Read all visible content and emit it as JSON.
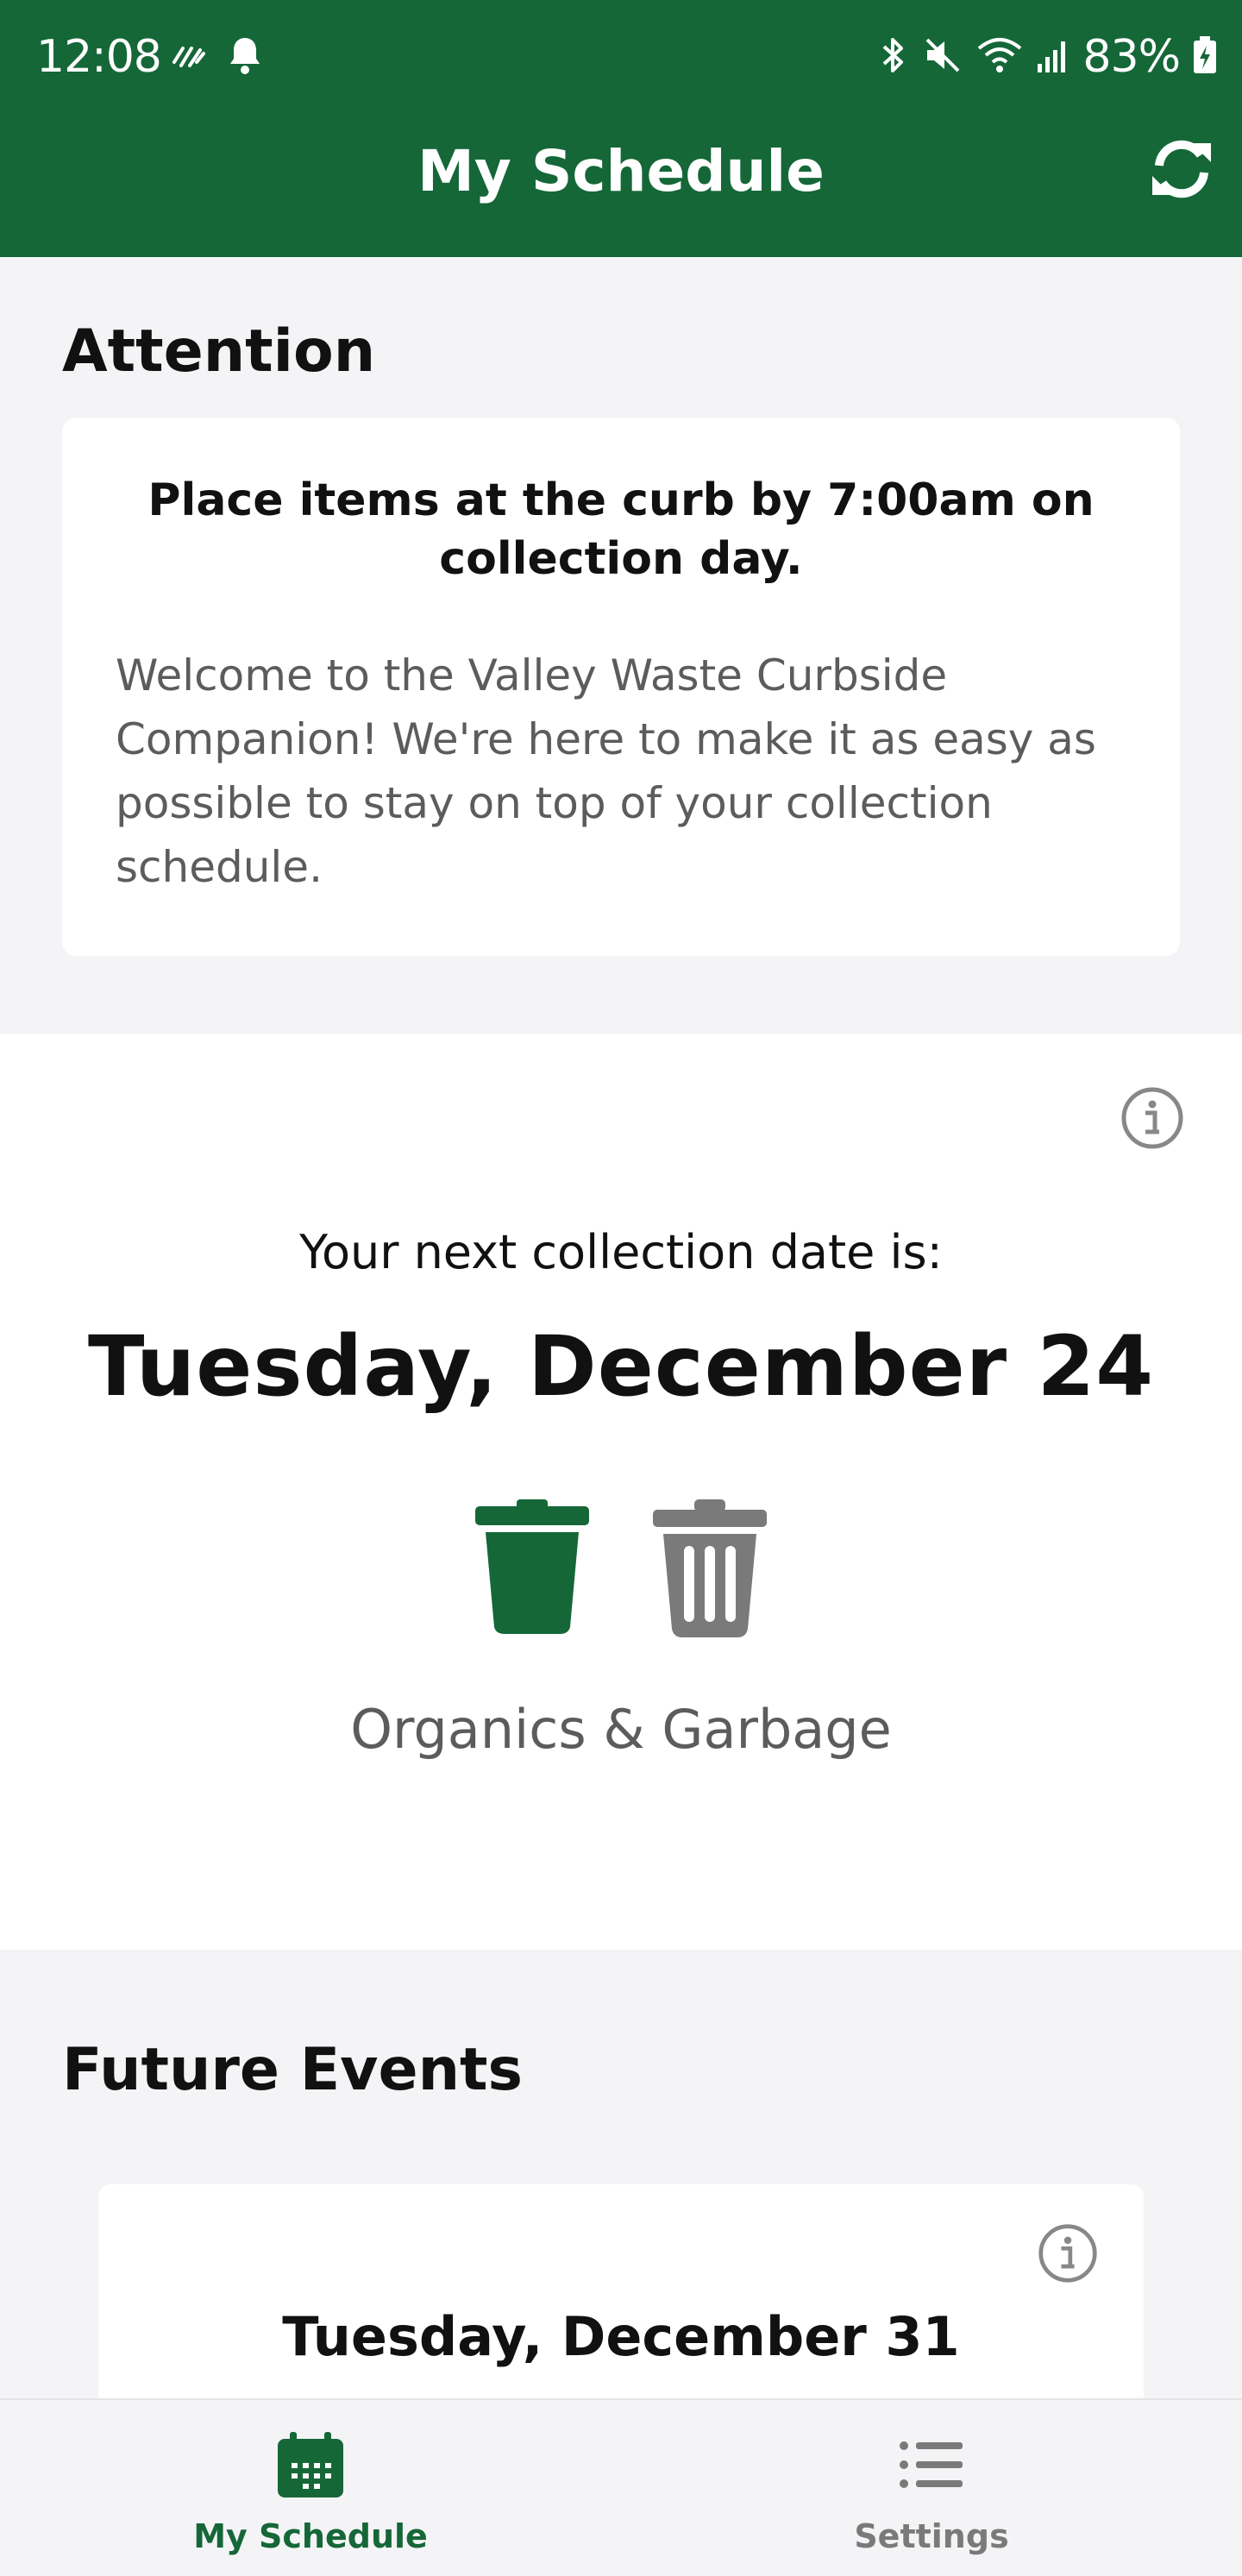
{
  "status_bar": {
    "time": "12:08",
    "battery": "83%",
    "icons": [
      "activity-icon",
      "notification-bell-icon",
      "bluetooth-icon",
      "mute-icon",
      "wifi-icon",
      "signal-icon",
      "battery-charging-icon"
    ]
  },
  "app_bar": {
    "title": "My Schedule",
    "refresh_icon": "refresh-icon"
  },
  "attention": {
    "heading": "Attention",
    "card_title": "Place items at the curb by 7:00am on collection day.",
    "card_body": "Welcome to the Valley Waste Curbside Companion! We're here to make it as easy as possible to stay on top of your collection schedule."
  },
  "next_collection": {
    "label": "Your next collection date is:",
    "date": "Tuesday, December 24",
    "bins": [
      {
        "type": "organics",
        "icon": "organics-bin-icon",
        "color": "#156738"
      },
      {
        "type": "garbage",
        "icon": "garbage-bin-icon",
        "color": "#7a7a7a"
      }
    ],
    "bins_label": "Organics & Garbage"
  },
  "future_events": {
    "heading": "Future Events",
    "items": [
      {
        "date": "Tuesday, December 31"
      }
    ]
  },
  "bottom_nav": {
    "items": [
      {
        "label": "My Schedule",
        "icon": "calendar-icon",
        "active": true
      },
      {
        "label": "Settings",
        "icon": "list-icon",
        "active": false
      }
    ]
  },
  "colors": {
    "brand_green": "#156738",
    "background": "#f4f4f6",
    "muted_text": "#5c5c5c",
    "inactive": "#7a7a7a"
  }
}
